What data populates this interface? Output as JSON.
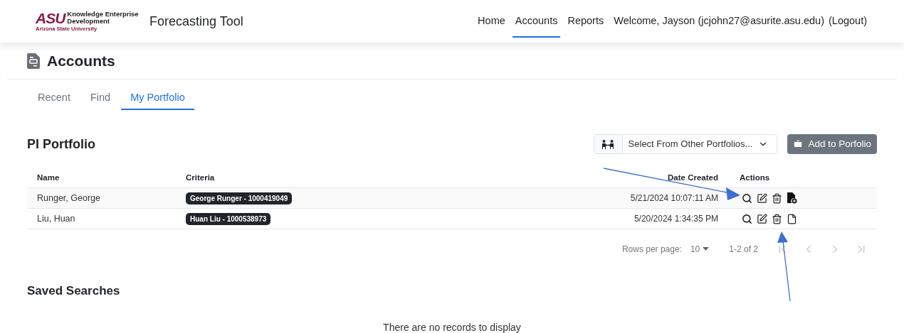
{
  "header": {
    "logo": {
      "mark": "ASU",
      "line_1": "Knowledge Enterprise",
      "line_2": "Development",
      "subtitle": "Arizona State University"
    },
    "app_title": "Forecasting Tool",
    "nav": [
      {
        "label": "Home",
        "selected": false
      },
      {
        "label": "Accounts",
        "selected": true
      },
      {
        "label": "Reports",
        "selected": false
      }
    ],
    "welcome": "Welcome, Jayson (jcjohn27@asurite.asu.edu)",
    "logout": "(Logout)"
  },
  "page_title": "Accounts",
  "tabs": [
    {
      "label": "Recent",
      "selected": false
    },
    {
      "label": "Find",
      "selected": false
    },
    {
      "label": "My Portfolio",
      "selected": true
    }
  ],
  "pi_portfolio": {
    "title": "PI Portfolio",
    "select": {
      "placeholder": "Select From Other Portfolios..."
    },
    "add_button": "Add to Porfolio",
    "columns": [
      "Name",
      "Criteria",
      "Date Created",
      "Actions"
    ],
    "rows": [
      {
        "name": "Runger, George",
        "criteria": "George Runger - 1000419049",
        "date_created": "5/21/2024 10:07:11 AM",
        "added": true
      },
      {
        "name": "Liu, Huan",
        "criteria": "Huan Liu - 1000538973",
        "date_created": "5/20/2024 1:34:35 PM",
        "added": false
      }
    ],
    "pagination": {
      "rows_per_page_label": "Rows per page:",
      "rows_per_page": "10",
      "range": "1-2 of 2",
      "buttons": [
        {
          "kind": "first",
          "disabled": true
        },
        {
          "kind": "prev",
          "disabled": true
        },
        {
          "kind": "next",
          "disabled": true
        },
        {
          "kind": "last",
          "disabled": true
        }
      ]
    }
  },
  "saved_searches": {
    "title": "Saved Searches",
    "empty_message": "There are no records to display"
  }
}
